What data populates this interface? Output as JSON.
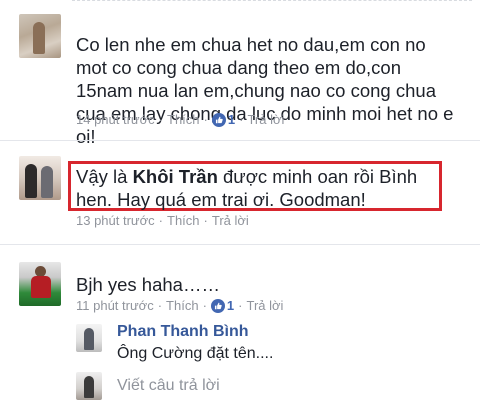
{
  "comments": [
    {
      "text": "Co len nhe em chua het no dau,em con no mot co cong chua dang theo em do,con 15nam nua lan em,chung nao co cong chua cua em lay chong da luc do minh moi het no e oi!",
      "time": "14 phút trước",
      "like_label": "Thích",
      "like_count": "1",
      "reply_label": "Trả lời"
    },
    {
      "text_before": "Vậy là ",
      "tag_name": "Khôi Trần",
      "text_after": " được minh oan rồi Bình hen. Hay quá em trai ơi. Goodman!",
      "time": "13 phút trước",
      "like_label": "Thích",
      "reply_label": "Trả lời",
      "highlight_color": "#d7262e"
    },
    {
      "text": "Bjh yes haha……",
      "time": "11 phút trước",
      "like_label": "Thích",
      "like_count": "1",
      "reply_label": "Trả lời"
    }
  ],
  "reply": {
    "author": "Phan Thanh Bình",
    "text": "Ông Cường đặt tên...."
  },
  "reply_input": {
    "placeholder": "Viết câu trả lời"
  },
  "colors": {
    "meta": "#90949c",
    "link": "#365899",
    "count": "#4267b2"
  },
  "icons": {
    "like": "thumbs-up-icon"
  }
}
